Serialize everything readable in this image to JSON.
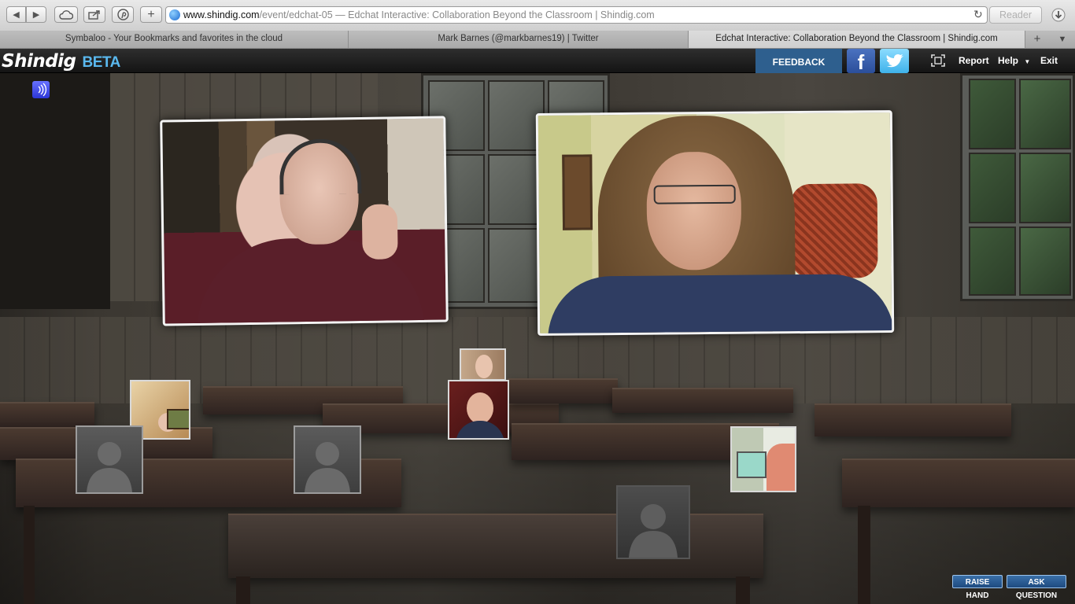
{
  "browser": {
    "url_host": "www.shindig.com",
    "url_path": "/event/edchat-05",
    "url_separator": " — ",
    "page_title": "Edchat Interactive: Collaboration Beyond the Classroom | Shindig.com",
    "reader_label": "Reader",
    "tabs": [
      {
        "label": "Symbaloo - Your Bookmarks and favorites in the cloud"
      },
      {
        "label": "Mark Barnes (@markbarnes19) | Twitter"
      },
      {
        "label": "Edchat Interactive: Collaboration Beyond the Classroom | Shindig.com"
      }
    ]
  },
  "app": {
    "logo": "Shindig",
    "beta": "BETA",
    "feedback_label": "FEEDBACK",
    "facebook_glyph": "f",
    "nav": {
      "report": "Report",
      "help": "Help",
      "exit": "Exit"
    }
  },
  "actions": {
    "raise_hand": "RAISE HAND",
    "ask_question": "ASK QUESTION"
  },
  "colors": {
    "feedback": "#2e5f8e",
    "beta": "#5ab8ee",
    "action_button": "#2a5d95"
  },
  "icons": [
    "back-icon",
    "forward-icon",
    "cloud-icon",
    "share-icon",
    "pinterest-icon",
    "add-icon",
    "globe-icon",
    "reload-icon",
    "download-icon",
    "facebook-icon",
    "twitter-icon",
    "fullscreen-icon",
    "chevron-down-icon",
    "signal-icon",
    "avatar-placeholder-icon"
  ]
}
